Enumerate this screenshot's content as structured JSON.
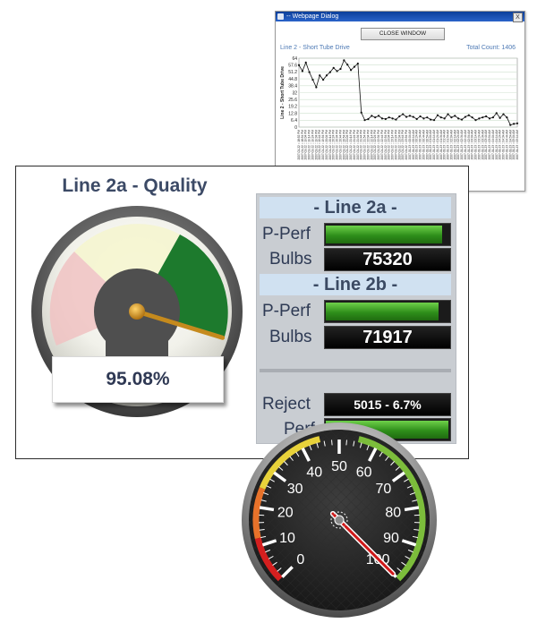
{
  "dialog": {
    "title": "-- Webpage Dialog",
    "close_x": "X",
    "close_button": "CLOSE WINDOW",
    "subtitle": "Line 2 - Short Tube Drive",
    "total_count": "Total Count: 1406",
    "chart_data": {
      "type": "line",
      "title": "",
      "ylabel": "Line 2 - Short Tube Drive",
      "yticks": [
        0,
        6.4,
        12.8,
        19.2,
        25.6,
        32,
        38.4,
        44.8,
        51.2,
        57.6,
        64
      ],
      "ylim": [
        0,
        64
      ],
      "x_labels": [
        "2007-01-22 :: 18:52 PM",
        "2007-01-22 :: 18:54 PM",
        "2007-01-22 :: 19:04 PM",
        "2007-01-22 :: 19:14 PM",
        "2007-01-22 :: 19:24 PM",
        "2007-01-22 :: 19:34 PM",
        "2007-01-22 :: 19:44 PM",
        "2007-01-22 :: 19:54 PM",
        "2007-01-22 :: 20:04 PM",
        "2007-01-22 :: 20:14 PM",
        "2007-01-22 :: 20:24 PM",
        "2007-01-22 :: 20:34 PM",
        "2007-01-22 :: 20:44 PM",
        "2007-01-22 :: 20:54 PM",
        "2007-01-22 :: 21:04 PM",
        "2007-01-22 :: 21:14 PM",
        "2007-01-22 :: 21:24 PM",
        "2007-01-22 :: 21:34 PM",
        "2007-01-22 :: 21:44 PM",
        "2007-01-22 :: 21:54 PM",
        "2007-01-22 :: 22:04 PM",
        "2007-01-22 :: 22:14 PM",
        "2007-01-22 :: 22:24 PM",
        "2007-01-22 :: 22:34 PM",
        "2007-01-22 :: 22:44 PM",
        "2007-01-22 :: 22:54 PM",
        "2007-01-22 :: 23:04 PM",
        "2007-01-22 :: 23:14 PM",
        "2007-01-22 :: 23:24 PM",
        "2007-01-22 :: 23:34 PM",
        "2007-01-22 :: 23:44 PM",
        "2007-01-22 :: 23:54 PM",
        "2007-01-23 :: 00:04 AM",
        "2007-01-23 :: 00:14 AM",
        "2007-01-23 :: 00:24 AM",
        "2007-01-23 :: 00:34 AM",
        "2007-01-23 :: 00:44 AM",
        "2007-01-23 :: 00:54 AM",
        "2007-01-23 :: 01:04 AM",
        "2007-01-23 :: 01:14 AM",
        "2007-01-23 :: 01:24 AM",
        "2007-01-23 :: 01:34 AM",
        "2007-01-23 :: 01:44 AM",
        "2007-01-23 :: 01:54 AM",
        "2007-01-23 :: 02:04 AM",
        "2007-01-23 :: 02:14 AM",
        "2007-01-23 :: 02:24 AM",
        "2007-01-23 :: 02:34 AM",
        "2007-01-23 :: 02:44 AM",
        "2007-01-23 :: 02:54 AM",
        "2007-01-23 :: 03:04 AM",
        "2007-01-23 :: 03:14 AM",
        "2007-01-23 :: 03:24 AM",
        "2007-01-23 :: 03:34 AM",
        "2007-01-23 :: 03:44 AM",
        "2007-01-23 :: 03:54 AM",
        "2007-01-23 :: 04:04 AM",
        "2007-01-23 :: 04:14 AM",
        "2007-01-23 :: 04:24 AM",
        "2007-01-23 :: 04:34 AM",
        "2007-01-23 :: 04:44 AM",
        "2007-01-23 :: 04:54 AM",
        "2007-01-23 :: 05:04 AM",
        "2007-01-23 :: 05:14 AM"
      ],
      "values": [
        57.6,
        52,
        60,
        51,
        44,
        37,
        48,
        44,
        48,
        51,
        55,
        52,
        54,
        62,
        58,
        53,
        56,
        59,
        13.5,
        6.5,
        7.5,
        10.5,
        9,
        10.5,
        8,
        7.5,
        9,
        8,
        7,
        10,
        12,
        9.5,
        10.5,
        9.5,
        7.5,
        10,
        8,
        9,
        7,
        6.5,
        11,
        9,
        8,
        12,
        9,
        10.5,
        8,
        7,
        9.5,
        11,
        9,
        6.5,
        8,
        9,
        10,
        8,
        9,
        13,
        8.5,
        12,
        9,
        2,
        3,
        3.5
      ]
    }
  },
  "panel": {
    "title": "Line 2a - Quality",
    "readout": "95.08%",
    "quality_gauge_fraction": 0.95,
    "line_a": {
      "header": "- Line 2a -",
      "pperf_label": "P-Perf",
      "pperf_fraction": 0.93,
      "bulbs_label": "Bulbs",
      "bulbs_value": "75320"
    },
    "line_b": {
      "header": "- Line 2b -",
      "pperf_label": "P-Perf",
      "pperf_fraction": 0.9,
      "bulbs_label": "Bulbs",
      "bulbs_value": "71917"
    },
    "reject_label": "Reject",
    "reject_value": "5015 - 6.7%",
    "perf_label": "Perf",
    "perf_fraction": 0.98
  },
  "speedometer": {
    "tick_labels": [
      "0",
      "10",
      "20",
      "30",
      "40",
      "50",
      "60",
      "70",
      "80",
      "90",
      "100"
    ],
    "value": 100,
    "colors": {
      "low": "#d51f1f",
      "mid": "#e8d23a",
      "high": "#7cbd3b"
    }
  }
}
